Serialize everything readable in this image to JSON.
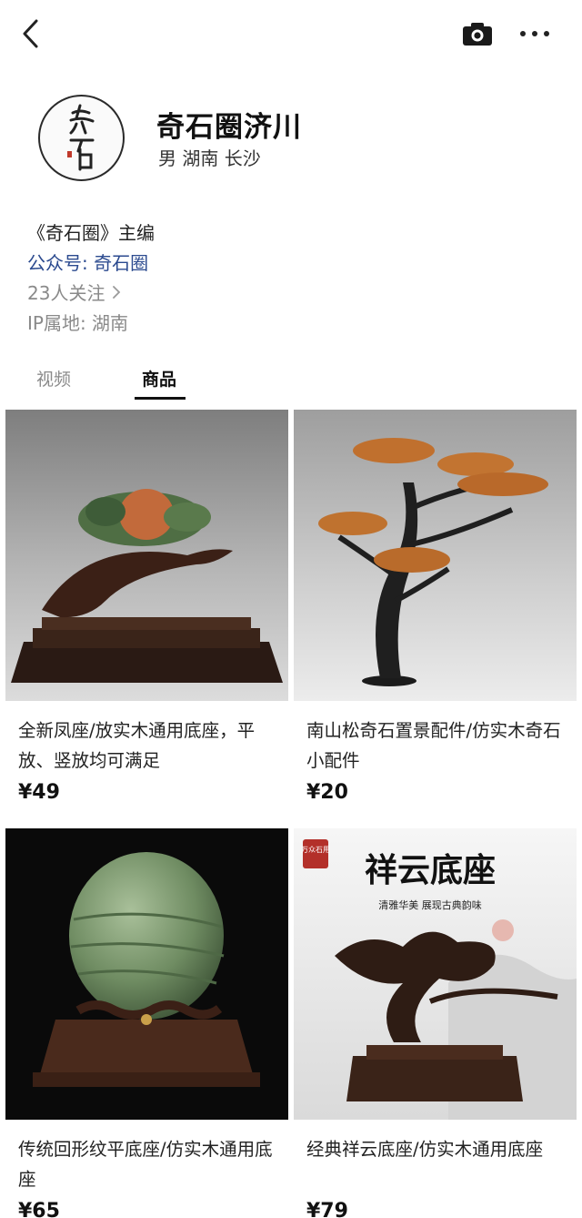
{
  "header": {
    "back_icon": "chevron-left-icon",
    "camera_icon": "camera-icon",
    "more_icon": "more-dots-icon"
  },
  "profile": {
    "name": "奇石圈济川",
    "meta": "男 湖南 长沙",
    "bio": "《奇石圈》主编",
    "official_account": "公众号: 奇石圈",
    "followers": "23人关注",
    "ip_location": "IP属地: 湖南"
  },
  "tabs": [
    {
      "label": "视频",
      "active": false
    },
    {
      "label": "商品",
      "active": true
    }
  ],
  "products": [
    {
      "title": "全新凤座/放实木通用底座，平放、竖放均可满足",
      "price": "¥49"
    },
    {
      "title": "南山松奇石置景配件/仿实木奇石小配件",
      "price": "¥20"
    },
    {
      "title": "传统回形纹平底座/仿实木通用底座",
      "price": "¥65"
    },
    {
      "title": "经典祥云底座/仿实木通用底座",
      "price": "¥79",
      "banner_title": "祥云底座",
      "banner_subtitle": "清雅华美 展现古典韵味",
      "badge": "万众石用"
    }
  ],
  "colors": {
    "link": "#2b4a8f",
    "muted": "#8a8a8a"
  }
}
